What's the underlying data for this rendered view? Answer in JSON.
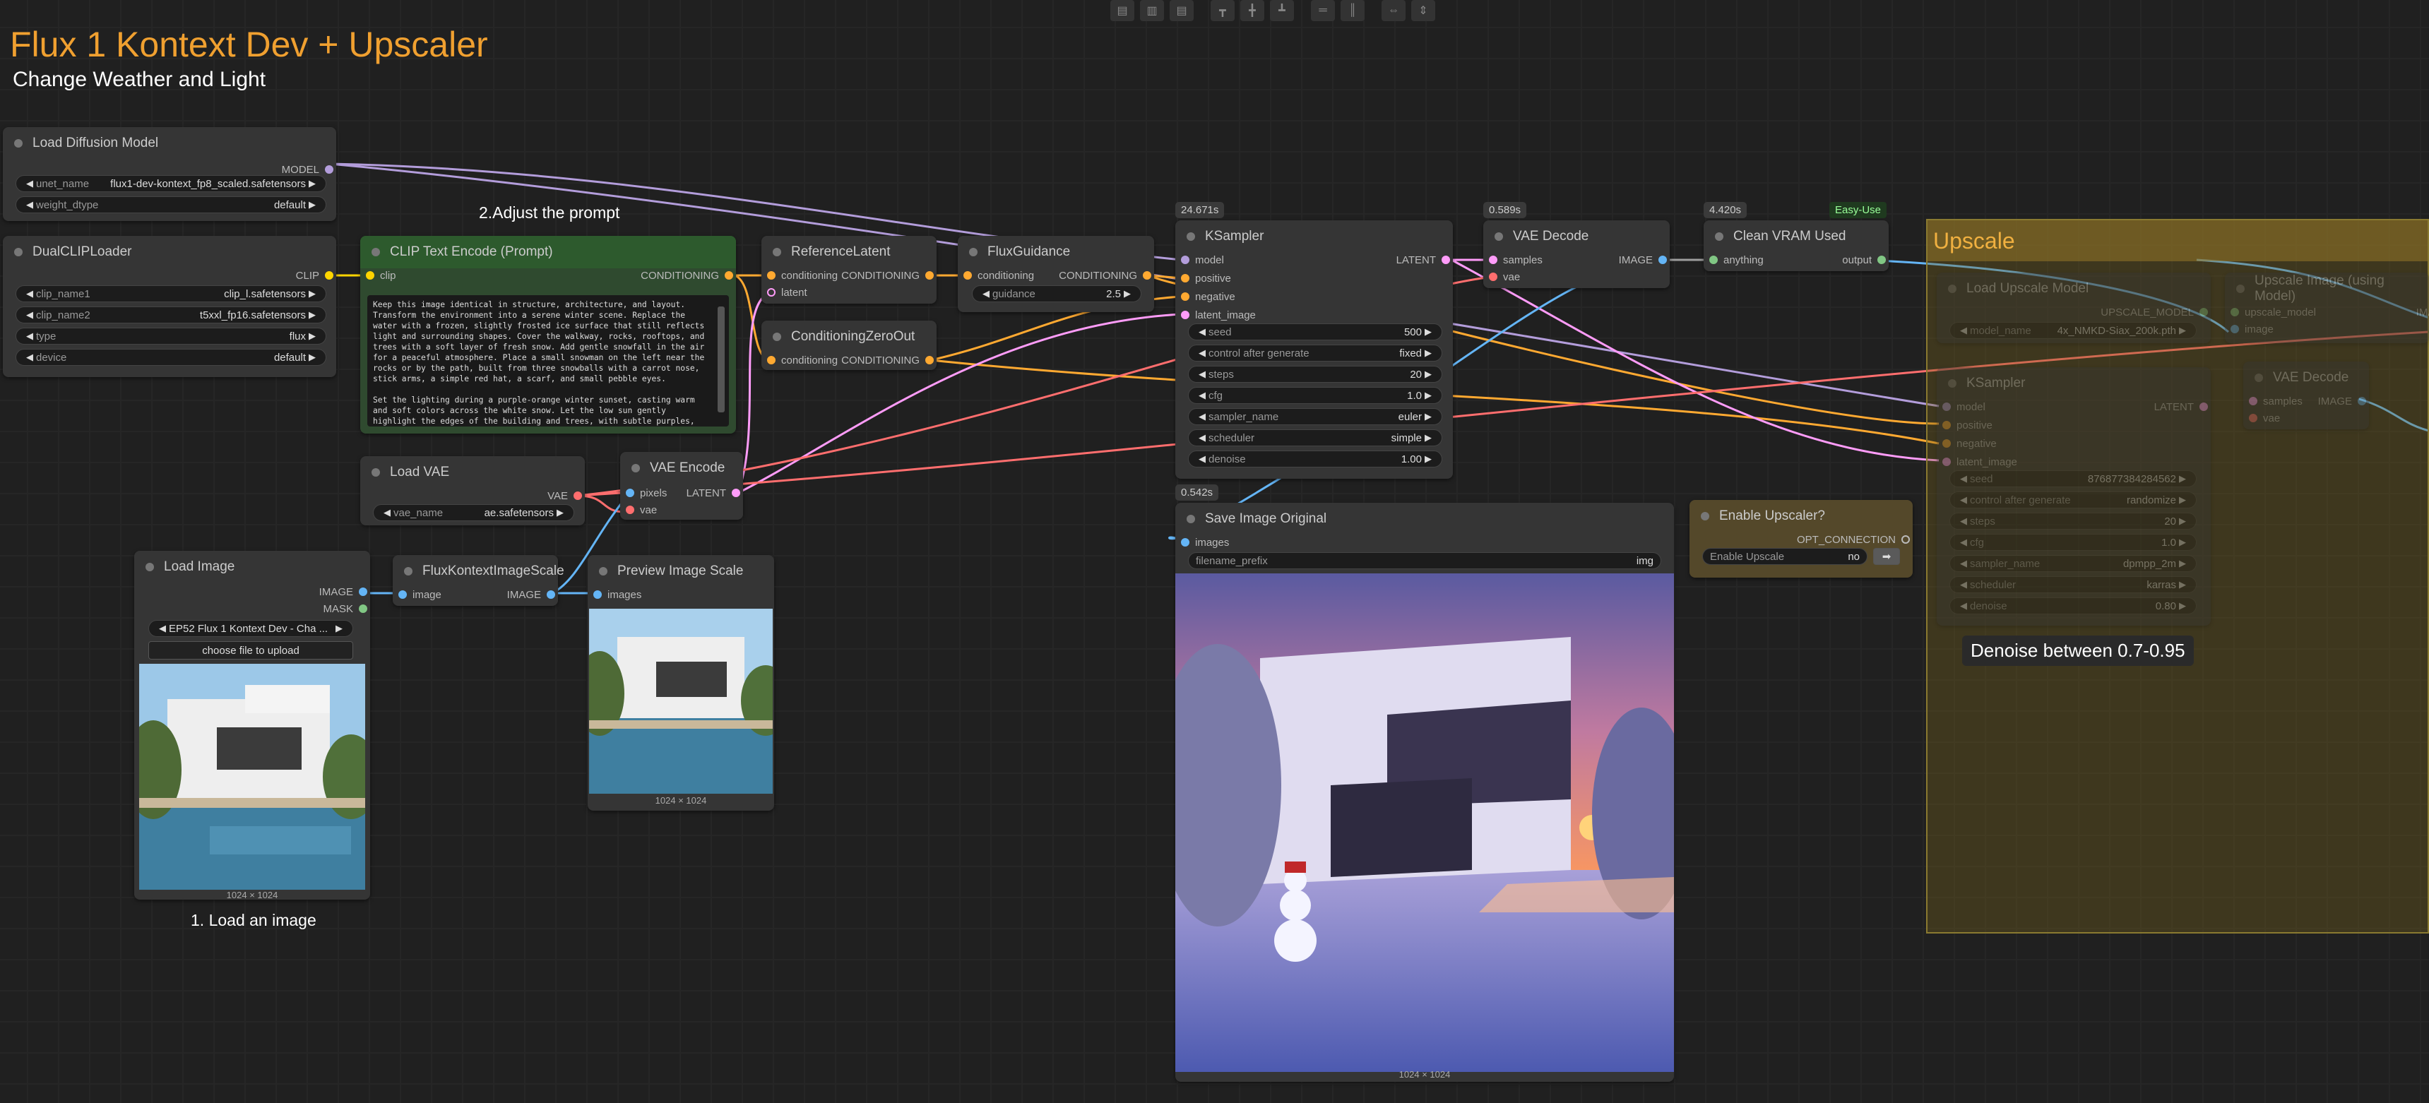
{
  "title": "Flux 1 Kontext Dev + Upscaler",
  "subtitle": "Change Weather and Light",
  "notes": {
    "adjust": "2.Adjust the prompt",
    "load": "1. Load an image",
    "denoise": "Denoise between 0.7-0.95"
  },
  "toolbar": [
    "align-left-icon",
    "align-center-icon",
    "align-right-icon",
    "align-top-icon",
    "align-middle-icon",
    "align-bottom-icon",
    "distribute-h-icon",
    "distribute-v-icon",
    "stretch-h-icon",
    "stretch-v-icon"
  ],
  "load_diffusion": {
    "title": "Load Diffusion Model",
    "out": "MODEL",
    "unet_label": "unet_name",
    "unet_value": "flux1-dev-kontext_fp8_scaled.safetensors",
    "dtype_label": "weight_dtype",
    "dtype_value": "default"
  },
  "dualclip": {
    "title": "DualCLIPLoader",
    "out": "CLIP",
    "c1_label": "clip_name1",
    "c1_value": "clip_l.safetensors",
    "c2_label": "clip_name2",
    "c2_value": "t5xxl_fp16.safetensors",
    "type_label": "type",
    "type_value": "flux",
    "device_label": "device",
    "device_value": "default"
  },
  "clip_text": {
    "title": "CLIP Text Encode (Prompt)",
    "in": "clip",
    "out": "CONDITIONING",
    "prompt": "Keep this image identical in structure, architecture, and layout. Transform the environment into a serene winter scene. Replace the water with a frozen, slightly frosted ice surface that still reflects light and surrounding shapes. Cover the walkway, rocks, rooftops, and trees with a soft layer of fresh snow. Add gentle snowfall in the air for a peaceful atmosphere. Place a small snowman on the left near the rocks or by the path, built from three snowballs with a carrot nose, stick arms, a simple red hat, a scarf, and small pebble eyes.\n\nSet the lighting during a purple-orange winter sunset, casting warm and soft colors across the white snow. Let the low sun gently highlight the edges of the building and trees, with subtle purples,"
  },
  "ref_latent": {
    "title": "ReferenceLatent",
    "in1": "conditioning",
    "in2": "latent",
    "out": "CONDITIONING"
  },
  "cond_zero": {
    "title": "ConditioningZeroOut",
    "in": "conditioning",
    "out": "CONDITIONING"
  },
  "flux_guidance": {
    "title": "FluxGuidance",
    "in": "conditioning",
    "out": "CONDITIONING",
    "g_label": "guidance",
    "g_value": "2.5"
  },
  "ksampler": {
    "timer": "24.671s",
    "title": "KSampler",
    "in": [
      "model",
      "positive",
      "negative",
      "latent_image"
    ],
    "out": "LATENT",
    "widgets": [
      {
        "l": "seed",
        "v": "500"
      },
      {
        "l": "control after generate",
        "v": "fixed"
      },
      {
        "l": "steps",
        "v": "20"
      },
      {
        "l": "cfg",
        "v": "1.0"
      },
      {
        "l": "sampler_name",
        "v": "euler"
      },
      {
        "l": "scheduler",
        "v": "simple"
      },
      {
        "l": "denoise",
        "v": "1.00"
      }
    ]
  },
  "vae_decode": {
    "timer": "0.589s",
    "title": "VAE Decode",
    "in1": "samples",
    "in2": "vae",
    "out": "IMAGE"
  },
  "clean_vram": {
    "timer": "4.420s",
    "badge": "Easy-Use",
    "title": "Clean VRAM Used",
    "in": "anything",
    "out": "output"
  },
  "load_vae": {
    "title": "Load VAE",
    "out": "VAE",
    "label": "vae_name",
    "value": "ae.safetensors"
  },
  "vae_encode": {
    "title": "VAE Encode",
    "in1": "pixels",
    "in2": "vae",
    "out": "LATENT"
  },
  "load_image": {
    "title": "Load Image",
    "out1": "IMAGE",
    "out2": "MASK",
    "file": "EP52 Flux 1 Kontext Dev - Cha ...",
    "upload": "choose file to upload",
    "caption": "1024 × 1024"
  },
  "kontext_scale": {
    "title": "FluxKontextImageScale",
    "in": "image",
    "out": "IMAGE"
  },
  "preview": {
    "title": "Preview Image Scale",
    "in": "images",
    "caption": "1024 × 1024"
  },
  "save_image": {
    "timer": "0.542s",
    "title": "Save Image Original",
    "in": "images",
    "prefix_label": "filename_prefix",
    "prefix_value": "img",
    "caption": "1024 × 1024"
  },
  "enable_upscaler": {
    "title": "Enable Upscaler?",
    "out": "OPT_CONNECTION",
    "label": "Enable Upscale",
    "value": "no"
  },
  "upscale_group": {
    "title": "Upscale"
  },
  "up_load_model": {
    "title": "Load Upscale Model",
    "out": "UPSCALE_MODEL",
    "label": "model_name",
    "value": "4x_NMKD-Siax_200k.pth"
  },
  "up_image": {
    "title": "Upscale Image (using Model)",
    "in1": "upscale_model",
    "in2": "image",
    "out": "IMAGE"
  },
  "up_ksampler": {
    "title": "KSampler",
    "in": [
      "model",
      "positive",
      "negative",
      "latent_image"
    ],
    "out": "LATENT",
    "widgets": [
      {
        "l": "seed",
        "v": "876877384284562"
      },
      {
        "l": "control after generate",
        "v": "randomize"
      },
      {
        "l": "steps",
        "v": "20"
      },
      {
        "l": "cfg",
        "v": "1.0"
      },
      {
        "l": "sampler_name",
        "v": "dpmpp_2m"
      },
      {
        "l": "scheduler",
        "v": "karras"
      },
      {
        "l": "denoise",
        "v": "0.80"
      }
    ]
  },
  "up_vae_decode": {
    "title": "VAE Decode",
    "in1": "samples",
    "in2": "vae",
    "out": "IMAGE"
  },
  "colors": {
    "model": "#b39ddb",
    "clip": "#ffd500",
    "conditioning": "#ffa931",
    "latent": "#ff9cf9",
    "vae": "#ff6e6e",
    "image": "#64b5f6",
    "mask": "#81c784"
  }
}
